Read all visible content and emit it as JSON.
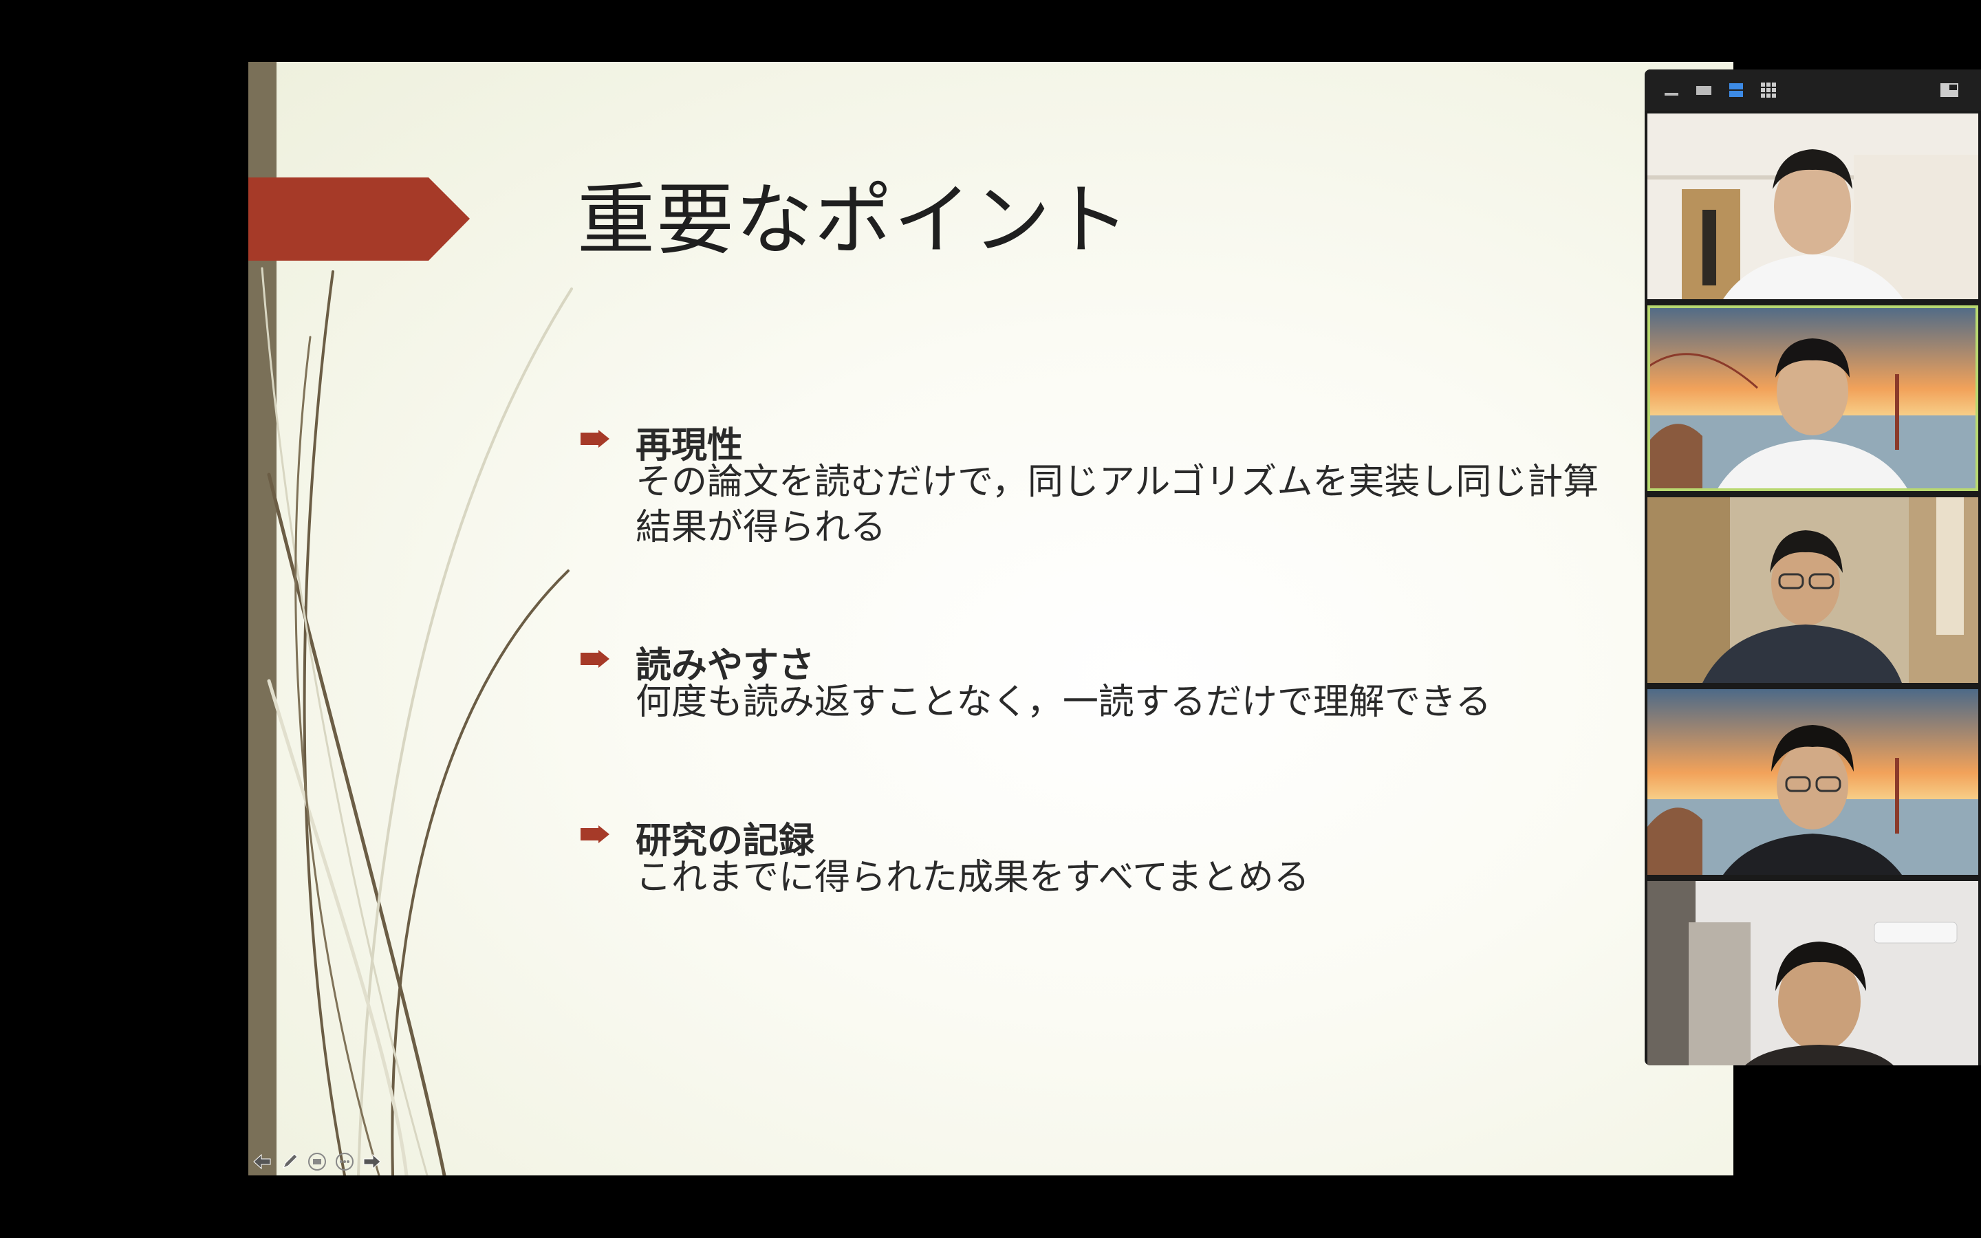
{
  "slide": {
    "title": "重要なポイント",
    "bullets": [
      {
        "heading": "再現性",
        "body": "その論文を読むだけで，同じアルゴリズムを実装し同じ計算結果が得られる"
      },
      {
        "heading": "読みやすさ",
        "body": "何度も読み返すことなく，一読するだけで理解できる"
      },
      {
        "heading": "研究の記録",
        "body": "これまでに得られた成果をすべてまとめる"
      }
    ],
    "accent_color": "#a63a28",
    "sidebar_color": "#7a7058",
    "nav_icons": [
      "arrow-left-icon",
      "pen-icon",
      "slides-icon",
      "more-icon",
      "arrow-right-icon"
    ]
  },
  "video_panel": {
    "toolbar_icons": [
      "minimize-icon",
      "single-video-icon",
      "speaker-view-icon",
      "gallery-view-icon",
      "popout-icon"
    ],
    "active_view": "speaker-view-icon",
    "active_border_color": "#b8d870",
    "participant_count": 5
  }
}
